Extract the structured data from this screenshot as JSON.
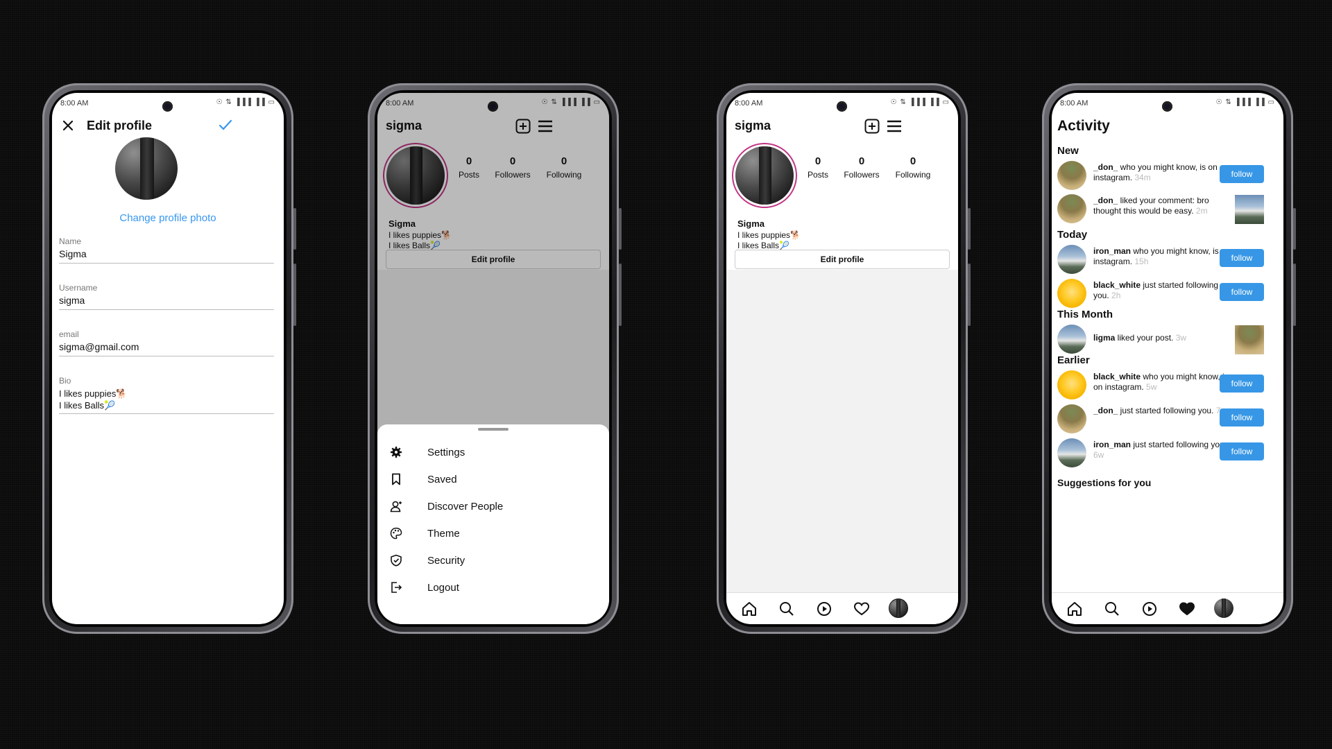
{
  "status": {
    "time": "8:00 AM",
    "signal": "☉ ⇅ ▐▐▐ ▐▐ ▭"
  },
  "edit_profile": {
    "title": "Edit profile",
    "change_photo": "Change profile photo",
    "fields": [
      {
        "label": "Name",
        "value": "Sigma"
      },
      {
        "label": "Username",
        "value": "sigma"
      },
      {
        "label": "email",
        "value": "sigma@gmail.com"
      },
      {
        "label": "Bio",
        "value_line1": "I likes puppies🐕",
        "value_line2": "I likes Balls🎾"
      }
    ]
  },
  "profile": {
    "username": "sigma",
    "stats": [
      {
        "value": "0",
        "label": "Posts"
      },
      {
        "value": "0",
        "label": "Followers"
      },
      {
        "value": "0",
        "label": "Following"
      }
    ],
    "display_name": "Sigma",
    "bio_line1": "I likes puppies🐕",
    "bio_line2": "I likes Balls🎾",
    "edit_button": "Edit profile"
  },
  "menu": {
    "items": [
      {
        "label": "Settings",
        "icon": "gear-icon"
      },
      {
        "label": "Saved",
        "icon": "bookmark-icon"
      },
      {
        "label": "Discover People",
        "icon": "add-person-icon"
      },
      {
        "label": "Theme",
        "icon": "palette-icon"
      },
      {
        "label": "Security",
        "icon": "shield-icon"
      },
      {
        "label": "Logout",
        "icon": "logout-icon"
      }
    ]
  },
  "activity": {
    "title": "Activity",
    "sections": {
      "new": "New",
      "today": "Today",
      "this_month": "This Month",
      "earlier": "Earlier",
      "suggestions": "Suggestions for you"
    },
    "follow_label": "follow",
    "rows": [
      {
        "user": "_don_",
        "text": " who you might know, is on instagram.",
        "ago": "34m",
        "action": "follow"
      },
      {
        "user": "_don_",
        "text": " liked your comment: bro thought this would be easy.",
        "ago": "2m",
        "action": "thumb"
      },
      {
        "user": "iron_man",
        "text": " who you might know, is on instagram.",
        "ago": "15h",
        "action": "follow"
      },
      {
        "user": "black_white",
        "text": " just started following you.",
        "ago": "2h",
        "action": "follow"
      },
      {
        "user": "ligma",
        "text": " liked your post.",
        "ago": "3w",
        "action": "thumb"
      },
      {
        "user": "black_white",
        "text": " who you might know, is on instagram.",
        "ago": "5w",
        "action": "follow"
      },
      {
        "user": "_don_",
        "text": " just started following you.",
        "ago": "7w",
        "action": "follow"
      },
      {
        "user": "iron_man",
        "text": " just started following you.",
        "ago": "6w",
        "action": "follow"
      }
    ]
  },
  "colors": {
    "accent": "#3797e6",
    "story_ring": "#c13584",
    "link": "#3897f0"
  }
}
